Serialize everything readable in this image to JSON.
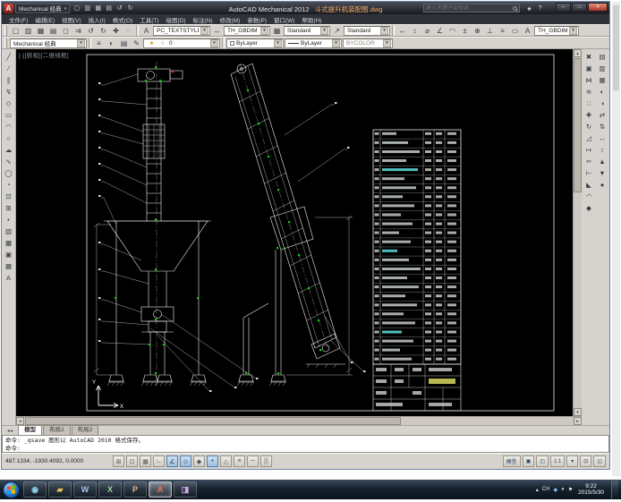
{
  "titlebar": {
    "logo_letter": "A",
    "workspace": "Mechanical 经典",
    "qat_icons": [
      {
        "name": "new",
        "g": "▢"
      },
      {
        "name": "open",
        "g": "▥"
      },
      {
        "name": "save",
        "g": "▦"
      },
      {
        "name": "plot",
        "g": "▤"
      },
      {
        "name": "undo",
        "g": "↺"
      },
      {
        "name": "redo",
        "g": "↻"
      }
    ],
    "title_app": "AutoCAD Mechanical 2012",
    "title_doc": "斗式提升机装配图.dwg",
    "search_placeholder": "键入关键字或短语",
    "info_icons": [
      {
        "name": "exchange-star",
        "g": "★"
      },
      {
        "name": "help",
        "g": "?"
      }
    ],
    "min_label": "─",
    "max_label": "□",
    "close_label": "✕"
  },
  "menubar": {
    "items": [
      "文件(F)",
      "编辑(E)",
      "视图(V)",
      "插入(I)",
      "格式(O)",
      "工具(T)",
      "绘图(D)",
      "标注(N)",
      "修改(M)",
      "参数(P)",
      "窗口(W)",
      "帮助(H)"
    ]
  },
  "toolbars": {
    "row1": {
      "left_icons": [
        {
          "name": "new",
          "g": "▢"
        },
        {
          "name": "open",
          "g": "▥"
        },
        {
          "name": "save",
          "g": "▦"
        },
        {
          "name": "plot",
          "g": "▤"
        },
        {
          "name": "plot-preview",
          "g": "◻"
        },
        {
          "name": "publish",
          "g": "⇉"
        },
        {
          "name": "undo",
          "g": "↺"
        },
        {
          "name": "redo",
          "g": "↻"
        },
        {
          "name": "pan",
          "g": "✚"
        },
        {
          "name": "zoom-realtime",
          "g": "◌"
        }
      ],
      "launcher_text": "A",
      "launcher_dim": "↔",
      "launcher_table": "▦",
      "launcher_mleader": "↗",
      "text_style": "PC_TEXTSTYLE",
      "dim_style": "TH_GBDIM",
      "table_style": "Standard",
      "mleader_style": "Standard",
      "right_icons": [
        {
          "name": "dim-linear",
          "g": "↔"
        },
        {
          "name": "dim-aligned",
          "g": "↕"
        },
        {
          "name": "dim-diameter",
          "g": "⌀"
        },
        {
          "name": "dim-angular",
          "g": "∠"
        },
        {
          "name": "dim-arc-length",
          "g": "◠"
        },
        {
          "name": "dim-tolerance",
          "g": "±"
        },
        {
          "name": "dim-center-mark",
          "g": "⊕"
        },
        {
          "name": "dim-baseline",
          "g": "⊥"
        },
        {
          "name": "dim-continue",
          "g": "≡"
        },
        {
          "name": "dim-edit",
          "g": "▭"
        },
        {
          "name": "dim-text-edit",
          "g": "A"
        }
      ],
      "dim_style_box": "TH_GBDIM"
    },
    "row2": {
      "workspace": "Mechanical 经典",
      "icons_a": [
        {
          "name": "layer-properties",
          "g": "≡"
        },
        {
          "name": "layer-states",
          "g": "◐"
        },
        {
          "name": "layer-previous",
          "g": "▤"
        },
        {
          "name": "match-properties",
          "g": "✎"
        }
      ],
      "layer_icons": [
        {
          "name": "layer-on-bulb",
          "g": "●",
          "c": "#c8a830"
        },
        {
          "name": "layer-unlock",
          "g": "○",
          "c": "#777777"
        }
      ],
      "layer_value": "0",
      "color_value": "ByLayer",
      "linetype_value": "ByLayer",
      "plotstyle_value": "BYCOLOR"
    }
  },
  "left_toolbar": {
    "icons": [
      {
        "name": "line",
        "g": "╱"
      },
      {
        "name": "construction-line",
        "g": "∕"
      },
      {
        "name": "multiline",
        "g": "∥"
      },
      {
        "name": "polyline",
        "g": "↯"
      },
      {
        "name": "polygon",
        "g": "◇"
      },
      {
        "name": "rectangle",
        "g": "▭"
      },
      {
        "name": "arc",
        "g": "◠"
      },
      {
        "name": "circle",
        "g": "○"
      },
      {
        "name": "revision-cloud",
        "g": "☁"
      },
      {
        "name": "spline",
        "g": "∿"
      },
      {
        "name": "ellipse",
        "g": "◯"
      },
      {
        "name": "ellipse-arc",
        "g": "◔"
      },
      {
        "name": "insert-block",
        "g": "⊡"
      },
      {
        "name": "make-block",
        "g": "⊞"
      },
      {
        "name": "point",
        "g": "•"
      },
      {
        "name": "hatch",
        "g": "▨"
      },
      {
        "name": "gradient",
        "g": "▩"
      },
      {
        "name": "region",
        "g": "▣"
      },
      {
        "name": "table",
        "g": "▦"
      },
      {
        "name": "multiline-text",
        "g": "A"
      }
    ]
  },
  "right_toolbar": {
    "col1": [
      {
        "name": "erase",
        "g": "✖"
      },
      {
        "name": "copy",
        "g": "▣"
      },
      {
        "name": "mirror",
        "g": "⋈"
      },
      {
        "name": "offset",
        "g": "≋"
      },
      {
        "name": "array",
        "g": "∷"
      },
      {
        "name": "move",
        "g": "✚"
      },
      {
        "name": "rotate",
        "g": "↻"
      },
      {
        "name": "scale",
        "g": "◿"
      },
      {
        "name": "stretch",
        "g": "↦"
      },
      {
        "name": "trim",
        "g": "✂"
      },
      {
        "name": "extend",
        "g": "⊢"
      },
      {
        "name": "chamfer",
        "g": "◣"
      },
      {
        "name": "fillet",
        "g": "◠"
      },
      {
        "name": "explode",
        "g": "◆"
      }
    ],
    "col2": [
      {
        "name": "draworder-front",
        "g": "▤"
      },
      {
        "name": "draworder-back",
        "g": "▥"
      },
      {
        "name": "group",
        "g": "▦"
      },
      {
        "name": "ungroup",
        "g": "◐"
      },
      {
        "name": "edit-polyline",
        "g": "◑"
      },
      {
        "name": "edit-spline",
        "g": "⇄"
      },
      {
        "name": "edit-hatch",
        "g": "⇅"
      },
      {
        "name": "align",
        "g": "↔"
      },
      {
        "name": "measure",
        "g": "↕"
      },
      {
        "name": "move-up",
        "g": "▲"
      },
      {
        "name": "move-down",
        "g": "▼"
      },
      {
        "name": "divide",
        "g": "●"
      }
    ]
  },
  "canvas": {
    "viewport_label": "[-][俯视][二维线框]",
    "ucs_x_label": "X",
    "ucs_y_label": "Y",
    "bom_rows": 26
  },
  "tabs": {
    "items": [
      "模型",
      "布局1",
      "布局2"
    ],
    "active_index": 0
  },
  "command": {
    "lines": [
      "命令: _qsave 图形以 AutoCAD 2010 格式保存。",
      "命令:"
    ]
  },
  "statusbar": {
    "coords": "487.1334, -1930.4092, 0.0000",
    "toggles": [
      {
        "name": "infer-constraints",
        "g": "⊞",
        "on": false
      },
      {
        "name": "snap-mode",
        "g": "⊡",
        "on": false
      },
      {
        "name": "grid-display",
        "g": "▦",
        "on": false
      },
      {
        "name": "ortho-mode",
        "g": "∟",
        "on": false
      },
      {
        "name": "polar-tracking",
        "g": "∠",
        "on": true
      },
      {
        "name": "object-snap",
        "g": "◇",
        "on": true
      },
      {
        "name": "object-snap-3d",
        "g": "◆",
        "on": false
      },
      {
        "name": "object-snap-tracking",
        "g": "+",
        "on": true
      },
      {
        "name": "dynamic-ucs",
        "g": "△",
        "on": false
      },
      {
        "name": "dynamic-input",
        "g": "≡",
        "on": false
      },
      {
        "name": "lineweight-display",
        "g": "─",
        "on": false
      },
      {
        "name": "quick-properties",
        "g": "▒",
        "on": false
      }
    ],
    "right_items": [
      {
        "name": "model-space",
        "label": "模型"
      },
      {
        "name": "quick-view-layouts",
        "g": "▣"
      },
      {
        "name": "quick-view-drawings",
        "g": "◰"
      },
      {
        "name": "annotation-scale",
        "label": "1:1"
      },
      {
        "name": "annotation-visibility",
        "g": "▾"
      },
      {
        "name": "lock-ui",
        "g": "⊡"
      },
      {
        "name": "clean-screen",
        "g": "◱"
      }
    ]
  },
  "taskbar": {
    "apps": [
      {
        "name": "windows-media-player",
        "g": "◉",
        "c": "#8fd4f0"
      },
      {
        "name": "windows-explorer",
        "g": "▰",
        "c": "#e8c35a"
      },
      {
        "name": "word",
        "g": "W",
        "c": "#a8c4f0"
      },
      {
        "name": "excel",
        "g": "X",
        "c": "#9fd49f"
      },
      {
        "name": "powerpoint",
        "g": "P",
        "c": "#f0b08a"
      },
      {
        "name": "autocad",
        "g": "A",
        "c": "#ff6a55",
        "active": true
      },
      {
        "name": "image-viewer",
        "g": "◨",
        "c": "#c8a8e8"
      }
    ],
    "tray_icons": [
      {
        "name": "hidden-icons",
        "g": "▴"
      },
      {
        "name": "ime-language",
        "label": "CH"
      },
      {
        "name": "security-center",
        "g": "◆",
        "c": "#7ec2f2"
      },
      {
        "name": "network",
        "g": "●",
        "c": "#9fd49f"
      },
      {
        "name": "action-center",
        "g": "⚑",
        "c": "#e8e8e8"
      }
    ],
    "clock_time": "9:22",
    "clock_date": "2015/5/30"
  }
}
